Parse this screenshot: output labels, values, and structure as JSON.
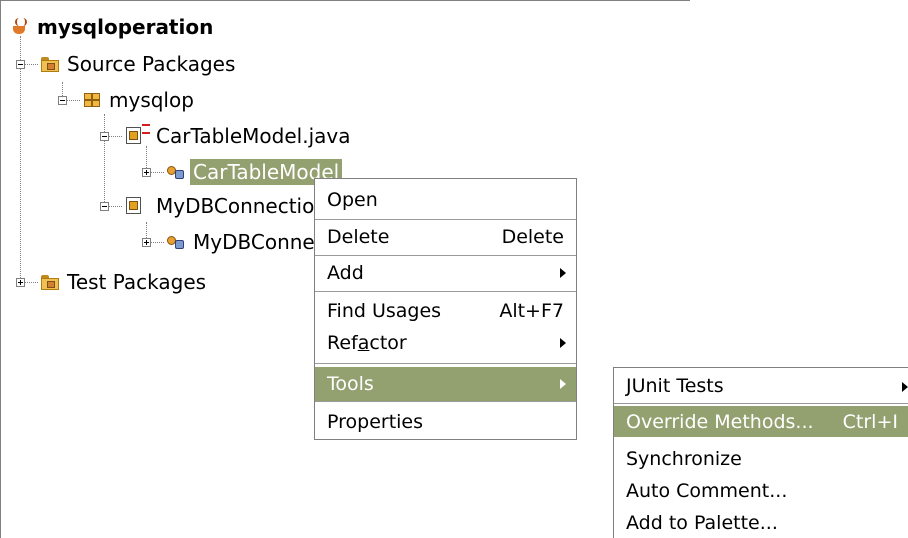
{
  "tree": {
    "project": "mysqloperation",
    "source_packages": "Source Packages",
    "package": "mysqlop",
    "file1": "CarTableModel.java",
    "class1": "CarTableModel",
    "file2": "MyDBConnection.java",
    "class2": "MyDBConnection",
    "test_packages": "Test Packages"
  },
  "context_menu": {
    "open": "Open",
    "delete": "Delete",
    "delete_shortcut": "Delete",
    "add": "Add",
    "find_usages": "Find Usages",
    "find_usages_shortcut": "Alt+F7",
    "refactor_pre": "Ref",
    "refactor_mnemonic": "a",
    "refactor_post": "ctor",
    "tools": "Tools",
    "properties": "Properties"
  },
  "tools_submenu": {
    "junit_tests": "JUnit Tests",
    "override_methods": "Override Methods...",
    "override_methods_shortcut": "Ctrl+I",
    "synchronize": "Synchronize",
    "auto_comment": "Auto Comment...",
    "add_to_palette": "Add to Palette..."
  },
  "colors": {
    "highlight": "#93a070",
    "border": "#7f7f7f"
  }
}
